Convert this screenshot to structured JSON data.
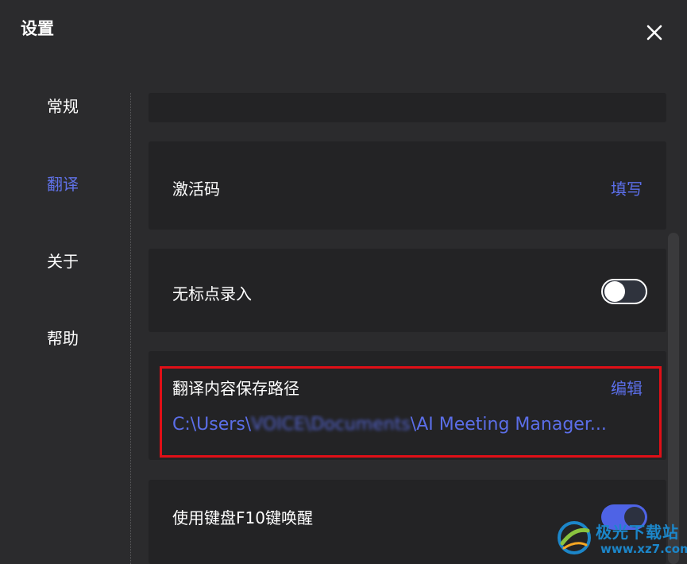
{
  "window": {
    "title": "设置",
    "close_icon": "close-icon"
  },
  "sidebar": {
    "items": [
      {
        "label": "常规",
        "active": false
      },
      {
        "label": "翻译",
        "active": true
      },
      {
        "label": "关于",
        "active": false
      },
      {
        "label": "帮助",
        "active": false
      }
    ]
  },
  "settings": {
    "activation": {
      "label": "激活码",
      "action": "填写"
    },
    "no_punctuation": {
      "label": "无标点录入",
      "enabled": false
    },
    "save_path": {
      "label": "翻译内容保存路径",
      "action": "编辑",
      "path_prefix": "C:\\Users\\",
      "path_blurred": "VOICE\\Documents",
      "path_suffix": "\\AI Meeting Manager..."
    },
    "hotkey_wake": {
      "label": "使用键盘F10键唤醒",
      "enabled": true
    }
  },
  "watermark": {
    "name": "极光下载站",
    "url": "www.xz7.com"
  },
  "colors": {
    "accent": "#5b6ee8",
    "active_nav": "#6072e8",
    "highlight_border": "#e00f17",
    "panel_bg": "#232325",
    "window_bg": "#2b2b2d"
  }
}
